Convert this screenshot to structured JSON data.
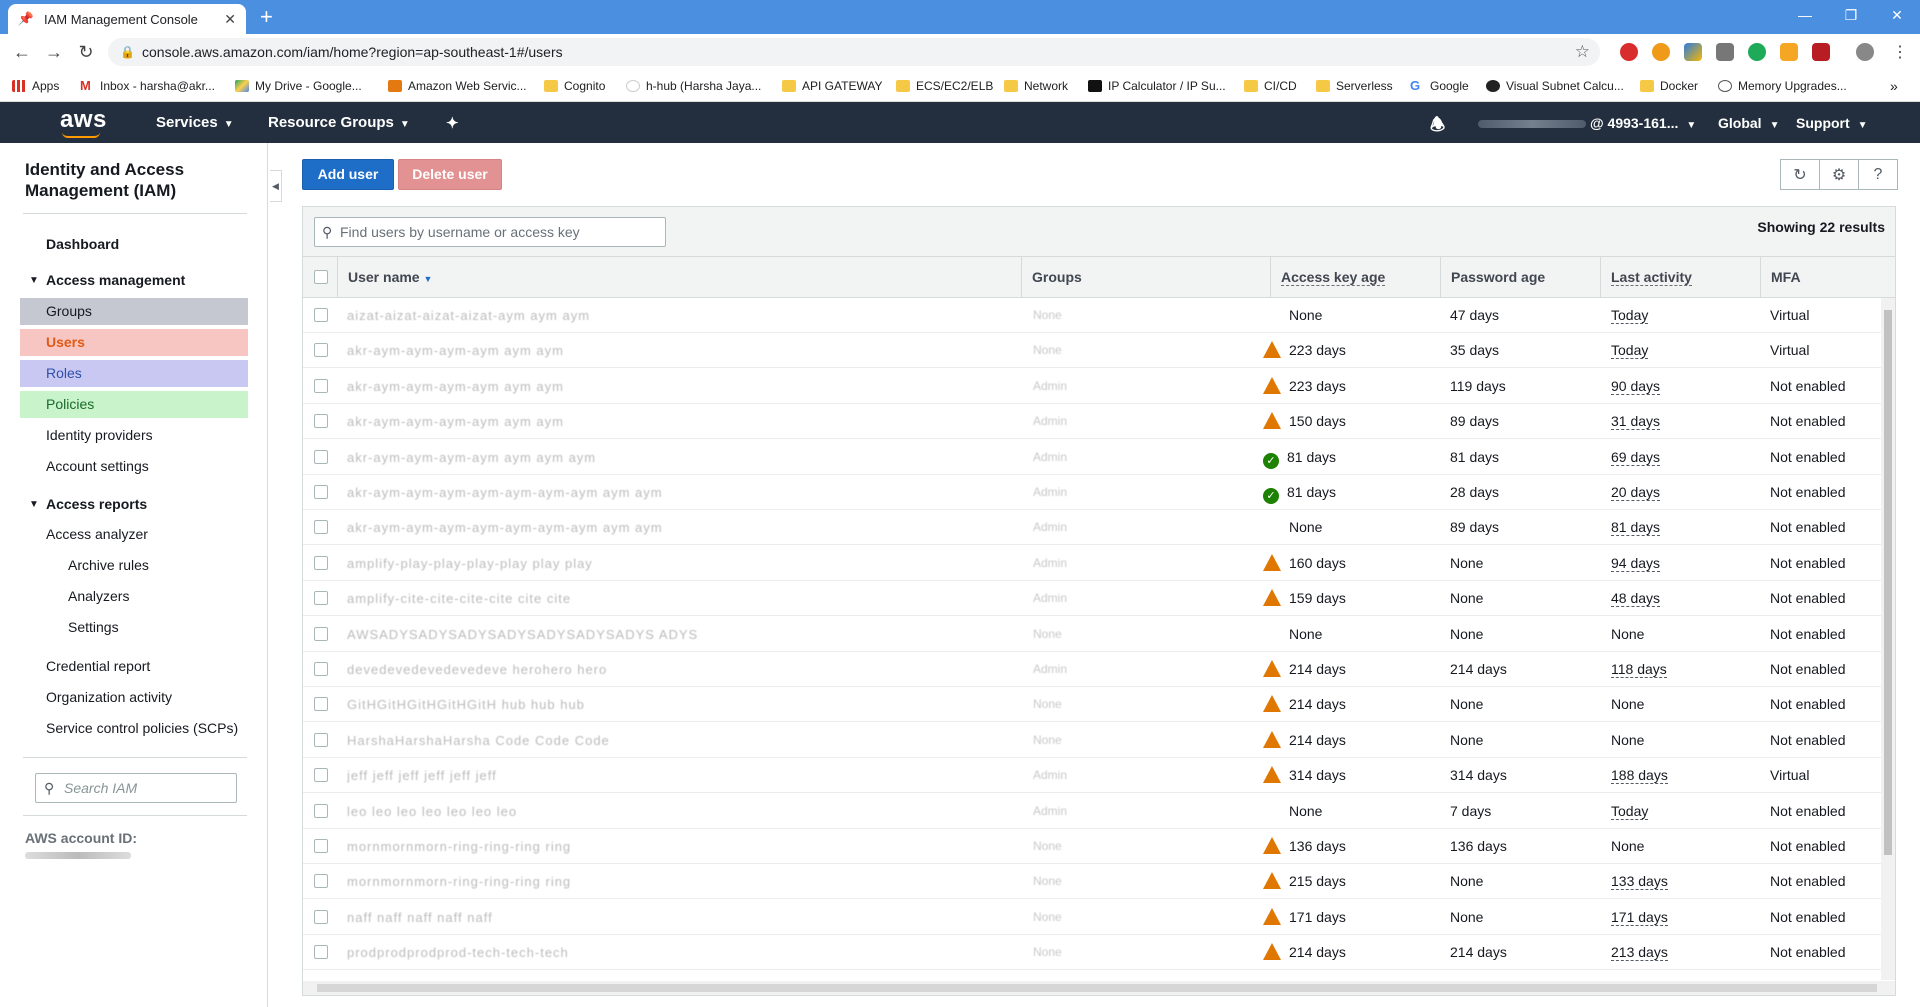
{
  "browser": {
    "tab_title": "IAM Management Console",
    "new_tab": "+",
    "url": "console.aws.amazon.com/iam/home?region=ap-southeast-1#/users"
  },
  "bookmarks": [
    {
      "label": "Apps",
      "icon": "apps-grid-icon"
    },
    {
      "label": "Inbox - harsha@akr...",
      "icon": "gmail-icon"
    },
    {
      "label": "My Drive - Google...",
      "icon": "drive-icon"
    },
    {
      "label": "Amazon Web Servic...",
      "icon": "aws-icon"
    },
    {
      "label": "Cognito",
      "icon": "folder-icon"
    },
    {
      "label": "h-hub (Harsha Jaya...",
      "icon": "github-icon"
    },
    {
      "label": "API GATEWAY",
      "icon": "folder-icon"
    },
    {
      "label": "ECS/EC2/ELB",
      "icon": "folder-icon"
    },
    {
      "label": "Network",
      "icon": "folder-icon"
    },
    {
      "label": "IP Calculator / IP Su...",
      "icon": "ip-icon"
    },
    {
      "label": "CI/CD",
      "icon": "folder-icon"
    },
    {
      "label": "Serverless",
      "icon": "folder-icon"
    },
    {
      "label": "Google",
      "icon": "google-icon"
    },
    {
      "label": "Visual Subnet Calcu...",
      "icon": "globe-icon"
    },
    {
      "label": "Docker",
      "icon": "folder-icon"
    },
    {
      "label": "Memory Upgrades...",
      "icon": "memory-icon"
    }
  ],
  "aws_nav": {
    "logo": "aws",
    "services": "Services",
    "resource_groups": "Resource Groups",
    "account": "@ 4993-161...",
    "region": "Global",
    "support": "Support"
  },
  "sidebar": {
    "title": "Identity and Access Management (IAM)",
    "dashboard": "Dashboard",
    "access_management": "Access management",
    "groups": "Groups",
    "users": "Users",
    "roles": "Roles",
    "policies": "Policies",
    "identity_providers": "Identity providers",
    "account_settings": "Account settings",
    "access_reports": "Access reports",
    "access_analyzer": "Access analyzer",
    "archive_rules": "Archive rules",
    "analyzers": "Analyzers",
    "settings": "Settings",
    "credential_report": "Credential report",
    "organization_activity": "Organization activity",
    "scps": "Service control policies (SCPs)",
    "search_placeholder": "Search IAM",
    "account_id_label": "AWS account ID:"
  },
  "actions": {
    "add_user": "Add user",
    "delete_user": "Delete user"
  },
  "table": {
    "search_placeholder": "Find users by username or access key",
    "showing": "Showing 22 results",
    "columns": {
      "user_name": "User name",
      "groups": "Groups",
      "access_key_age": "Access key age",
      "password_age": "Password age",
      "last_activity": "Last activity",
      "mfa": "MFA"
    },
    "rows": [
      {
        "user": "aizat-aizat-aizat-aizat-aym aym aym",
        "groups": "None",
        "ak": "None",
        "ak_status": "none",
        "pw": "47 days",
        "last": "Today",
        "last_link": true,
        "mfa": "Virtual"
      },
      {
        "user": "akr-aym-aym-aym-aym aym aym",
        "groups": "None",
        "ak": "223 days",
        "ak_status": "warning",
        "pw": "35 days",
        "last": "Today",
        "last_link": true,
        "mfa": "Virtual"
      },
      {
        "user": "akr-aym-aym-aym-aym aym aym",
        "groups": "Admin",
        "ak": "223 days",
        "ak_status": "warning",
        "pw": "119 days",
        "last": "90 days",
        "last_link": true,
        "mfa": "Not enabled"
      },
      {
        "user": "akr-aym-aym-aym-aym aym aym",
        "groups": "Admin",
        "ak": "150 days",
        "ak_status": "warning",
        "pw": "89 days",
        "last": "31 days",
        "last_link": true,
        "mfa": "Not enabled"
      },
      {
        "user": "akr-aym-aym-aym-aym aym aym aym",
        "groups": "Admin",
        "ak": "81 days",
        "ak_status": "ok",
        "pw": "81 days",
        "last": "69 days",
        "last_link": true,
        "mfa": "Not enabled"
      },
      {
        "user": "akr-aym-aym-aym-aym-aym-aym-aym aym aym",
        "groups": "Admin",
        "ak": "81 days",
        "ak_status": "ok",
        "pw": "28 days",
        "last": "20 days",
        "last_link": true,
        "mfa": "Not enabled"
      },
      {
        "user": "akr-aym-aym-aym-aym-aym-aym-aym aym aym",
        "groups": "Admin",
        "ak": "None",
        "ak_status": "none",
        "pw": "89 days",
        "last": "81 days",
        "last_link": true,
        "mfa": "Not enabled"
      },
      {
        "user": "amplify-play-play-play-play play play",
        "groups": "Admin",
        "ak": "160 days",
        "ak_status": "warning",
        "pw": "None",
        "last": "94 days",
        "last_link": true,
        "mfa": "Not enabled"
      },
      {
        "user": "amplify-cite-cite-cite-cite cite cite",
        "groups": "Admin",
        "ak": "159 days",
        "ak_status": "warning",
        "pw": "None",
        "last": "48 days",
        "last_link": true,
        "mfa": "Not enabled"
      },
      {
        "user": "AWSADYSADYSADYSADYSADYSADYSADYS ADYS",
        "groups": "None",
        "ak": "None",
        "ak_status": "none",
        "pw": "None",
        "last": "None",
        "last_link": false,
        "mfa": "Not enabled"
      },
      {
        "user": "devedevedevedevedeve herohero hero",
        "groups": "Admin",
        "ak": "214 days",
        "ak_status": "warning",
        "pw": "214 days",
        "last": "118 days",
        "last_link": true,
        "mfa": "Not enabled"
      },
      {
        "user": "GitHGitHGitHGitHGitH hub hub hub",
        "groups": "None",
        "ak": "214 days",
        "ak_status": "warning",
        "pw": "None",
        "last": "None",
        "last_link": false,
        "mfa": "Not enabled"
      },
      {
        "user": "HarshaHarshaHarsha Code Code Code",
        "groups": "None",
        "ak": "214 days",
        "ak_status": "warning",
        "pw": "None",
        "last": "None",
        "last_link": false,
        "mfa": "Not enabled"
      },
      {
        "user": "jeff jeff jeff jeff jeff jeff",
        "groups": "Admin",
        "ak": "314 days",
        "ak_status": "warning",
        "pw": "314 days",
        "last": "188 days",
        "last_link": true,
        "mfa": "Virtual"
      },
      {
        "user": "leo leo leo leo leo leo leo",
        "groups": "Admin",
        "ak": "None",
        "ak_status": "none",
        "pw": "7 days",
        "last": "Today",
        "last_link": true,
        "mfa": "Not enabled"
      },
      {
        "user": "mornmornmorn-ring-ring-ring ring",
        "groups": "None",
        "ak": "136 days",
        "ak_status": "warning",
        "pw": "136 days",
        "last": "None",
        "last_link": false,
        "mfa": "Not enabled"
      },
      {
        "user": "mornmornmorn-ring-ring-ring ring",
        "groups": "None",
        "ak": "215 days",
        "ak_status": "warning",
        "pw": "None",
        "last": "133 days",
        "last_link": true,
        "mfa": "Not enabled"
      },
      {
        "user": "naff naff naff naff naff",
        "groups": "None",
        "ak": "171 days",
        "ak_status": "warning",
        "pw": "None",
        "last": "171 days",
        "last_link": true,
        "mfa": "Not enabled"
      },
      {
        "user": "prodprodprodprod-tech-tech-tech",
        "groups": "None",
        "ak": "214 days",
        "ak_status": "warning",
        "pw": "214 days",
        "last": "213 days",
        "last_link": true,
        "mfa": "Not enabled"
      }
    ]
  },
  "colors": {
    "aws_nav_bg": "#232f3e",
    "primary_button": "#1e6ec8",
    "delete_button": "#e29293",
    "warning": "#e07700",
    "ok": "#1d8102"
  }
}
